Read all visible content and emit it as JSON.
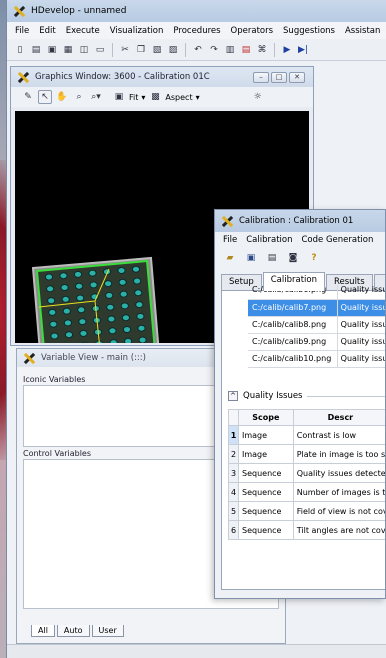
{
  "main": {
    "title": "HDevelop - unnamed",
    "menu": [
      "File",
      "Edit",
      "Execute",
      "Visualization",
      "Procedures",
      "Operators",
      "Suggestions",
      "Assistan"
    ]
  },
  "graphics": {
    "title": "Graphics Window: 3600 - Calibration 01C",
    "fit_label": "Fit",
    "aspect_label": "Aspect"
  },
  "variables": {
    "title": "Variable View - main (:::)",
    "iconic_label": "Iconic Variables",
    "control_label": "Control Variables",
    "tabs": [
      "All",
      "Auto",
      "User"
    ]
  },
  "calibration": {
    "title": "Calibration : Calibration 01",
    "menu": [
      "File",
      "Calibration",
      "Code Generation"
    ],
    "tabs": [
      "Setup",
      "Calibration",
      "Results"
    ],
    "images": [
      {
        "path": "C:/calib/calib6.png",
        "quality": "Quality issu"
      },
      {
        "path": "C:/calib/calib7.png",
        "quality": "Quality issu",
        "selected": true
      },
      {
        "path": "C:/calib/calib8.png",
        "quality": "Quality issu"
      },
      {
        "path": "C:/calib/calib9.png",
        "quality": "Quality issu"
      },
      {
        "path": "C:/calib/calib10.png",
        "quality": "Quality issu"
      }
    ],
    "quality_header": "Quality Issues",
    "table_headers": [
      "Scope",
      "Descr"
    ],
    "issues": [
      {
        "n": "1",
        "scope": "Image",
        "desc": "Contrast is low"
      },
      {
        "n": "2",
        "scope": "Image",
        "desc": "Plate in image is too sm"
      },
      {
        "n": "3",
        "scope": "Sequence",
        "desc": "Quality issues detected"
      },
      {
        "n": "4",
        "scope": "Sequence",
        "desc": "Number of images is to"
      },
      {
        "n": "5",
        "scope": "Sequence",
        "desc": "Field of view is not cov"
      },
      {
        "n": "6",
        "scope": "Sequence",
        "desc": "Tilt angles are not cove"
      }
    ]
  },
  "icons": [
    "app-logo-icon",
    "new-file-icon",
    "open-icon",
    "save-icon",
    "print-icon",
    "cut-icon",
    "copy-icon",
    "paste-icon",
    "undo-icon",
    "redo-icon",
    "run-icon",
    "step-icon",
    "help-icon"
  ]
}
